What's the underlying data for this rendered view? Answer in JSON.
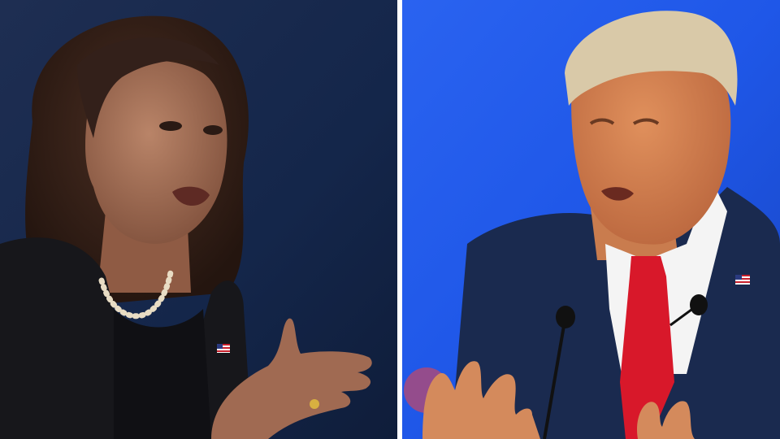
{
  "image": {
    "panels": [
      {
        "side": "left",
        "subject": "speaker-woman",
        "background_color": "#16284a",
        "jacket_color": "#17171b"
      },
      {
        "side": "right",
        "subject": "speaker-man",
        "background_color": "#1f57e8",
        "suit_color": "#1a2a4f",
        "tie_color": "#d8182a"
      }
    ],
    "divider_color": "#ffffff",
    "icons": [
      "american-flag-pin-icon",
      "microphone-icon"
    ]
  }
}
